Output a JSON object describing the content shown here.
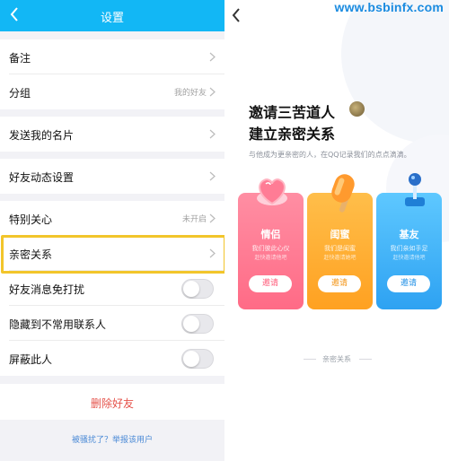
{
  "left": {
    "title": "设置",
    "rows": [
      {
        "label": "备注",
        "value": ""
      },
      {
        "label": "分组",
        "value": "我的好友"
      },
      {
        "label": "发送我的名片",
        "value": ""
      },
      {
        "label": "好友动态设置",
        "value": ""
      },
      {
        "label": "特别关心",
        "value": "未开启"
      },
      {
        "label": "亲密关系",
        "value": ""
      },
      {
        "label": "好友消息免打扰",
        "value": ""
      },
      {
        "label": "隐藏到不常用联系人",
        "value": ""
      },
      {
        "label": "屏蔽此人",
        "value": ""
      }
    ],
    "delete_label": "删除好友",
    "report_link": "被骚扰了？举报该用户"
  },
  "right": {
    "watermark": "www.bsbinfx.com",
    "heading_line1": "邀请三苦道人",
    "heading_line2": "建立亲密关系",
    "subtitle": "与他成为更亲密的人，在QQ记录我们的点点滴滴。",
    "cards": [
      {
        "name": "情侣",
        "desc1": "我们彼此心仪",
        "desc2": "赶快邀请他吧",
        "button": "邀请",
        "color": "#ff6b86"
      },
      {
        "name": "闺蜜",
        "desc1": "我们是闺蜜",
        "desc2": "赶快邀请她吧",
        "button": "邀请",
        "color": "#ffa121"
      },
      {
        "name": "基友",
        "desc1": "我们亲如手足",
        "desc2": "赶快邀请他吧",
        "button": "邀请",
        "color": "#2ea2f2"
      }
    ],
    "footer": "亲密关系"
  },
  "colors": {
    "header_blue": "#12b7f5",
    "highlight_yellow": "#f2c52b",
    "delete_red": "#e5534b",
    "link_blue": "#4b8ad6"
  }
}
